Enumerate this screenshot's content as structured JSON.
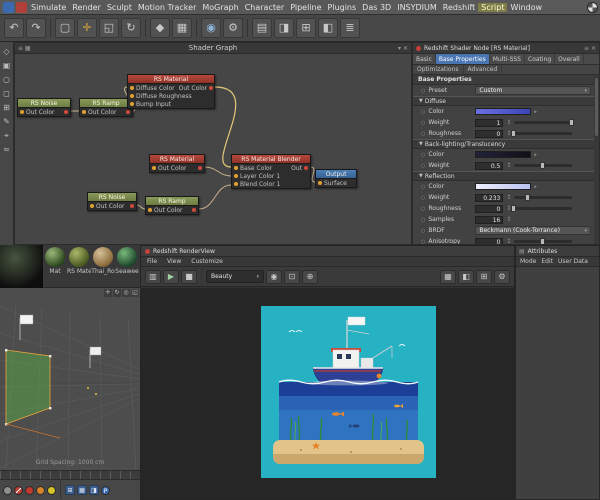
{
  "menubar": {
    "items": [
      "Simulate",
      "Render",
      "Sculpt",
      "Motion Tracker",
      "MoGraph",
      "Character",
      "Pipeline",
      "Plugins",
      "Das 3D",
      "INSYDIUM",
      "Redshift",
      "Script",
      "Window"
    ],
    "active_item": "Script"
  },
  "toolbar": {
    "tools": [
      "↶",
      "↷",
      "▢",
      "✛",
      "◱",
      "↻",
      "◆",
      "▦",
      "◉",
      "⚙",
      "▤",
      "◨",
      "⊞",
      "◧",
      "≣"
    ]
  },
  "left_toolbar": {
    "tools": [
      "◇",
      "▣",
      "○",
      "◻",
      "⊞",
      "✎",
      "⌖",
      "≈"
    ]
  },
  "shader_graph": {
    "title": "Shader Graph",
    "nodes": {
      "noise1": {
        "title": "RS Noise",
        "out": "Out Color"
      },
      "ramp1": {
        "title": "RS Ramp",
        "out": "Out Color"
      },
      "material1": {
        "title": "RS Material",
        "in1": "Diffuse Color",
        "in2": "Diffuse Roughness",
        "in3": "Bump Input",
        "out": "Out Color"
      },
      "material2": {
        "title": "RS Material",
        "out": "Out Color"
      },
      "noise2": {
        "title": "RS Noise",
        "out": "Out Color"
      },
      "ramp2": {
        "title": "RS Ramp",
        "out": "Out Color"
      },
      "blender": {
        "title": "RS Material Blender",
        "in1": "Base Color",
        "in2": "Layer Color 1",
        "in3": "Blend Color 1",
        "out": "Out"
      },
      "output": {
        "title": "Output",
        "in": "Surface"
      }
    }
  },
  "properties": {
    "title": "Redshift Shader Node [RS Material]",
    "tabs": [
      "Basic",
      "Base Properties",
      "Multi-SSS",
      "Coating",
      "Overall"
    ],
    "tabs2": [
      "Optimizations",
      "Advanced"
    ],
    "active_tab": "Base Properties",
    "section": "Base Properties",
    "preset_label": "Preset",
    "preset_value": "Custom",
    "groups": {
      "diffuse": {
        "title": "Diffuse",
        "color_label": "Color",
        "weight_label": "Weight",
        "weight": "1",
        "rough_label": "Roughness",
        "rough": "0"
      },
      "backlight": {
        "title": "Back-lighting/Translucency",
        "color_label": "Color",
        "weight_label": "Weight",
        "weight": "0.5"
      },
      "reflection": {
        "title": "Reflection",
        "color_label": "Color",
        "weight_label": "Weight",
        "weight": "0.233",
        "rough_label": "Roughness",
        "rough": "0",
        "samples_label": "Samples",
        "samples": "16",
        "brdf_label": "BRDF",
        "brdf": "Beckmann (Cook-Torrance)",
        "aniso_label": "Anisotropy",
        "aniso": "0"
      }
    }
  },
  "materials": {
    "items": [
      "Mat",
      "RS Mater",
      "Thai_Ro",
      "Seawee"
    ]
  },
  "viewport": {
    "grid_label": "Grid Spacing: 1000 cm"
  },
  "renderview": {
    "title": "Redshift RenderView",
    "menus": [
      "File",
      "View",
      "Customize"
    ],
    "pass": "Beauty"
  },
  "attributes": {
    "title": "Attributes",
    "menus": [
      "Mode",
      "Edit",
      "User Data"
    ]
  },
  "colors": {
    "node_material_header": "#a83c32",
    "node_utility_header": "#7e8b4f",
    "node_output_header": "#3a6f9e",
    "active_tab": "#4a76b4",
    "diffuse_color_swatch": "#5a5fd0",
    "reflection_color_swatch": "#cdd2f5",
    "wire": "#c9b28c",
    "render_sky": "#27b2c4"
  }
}
